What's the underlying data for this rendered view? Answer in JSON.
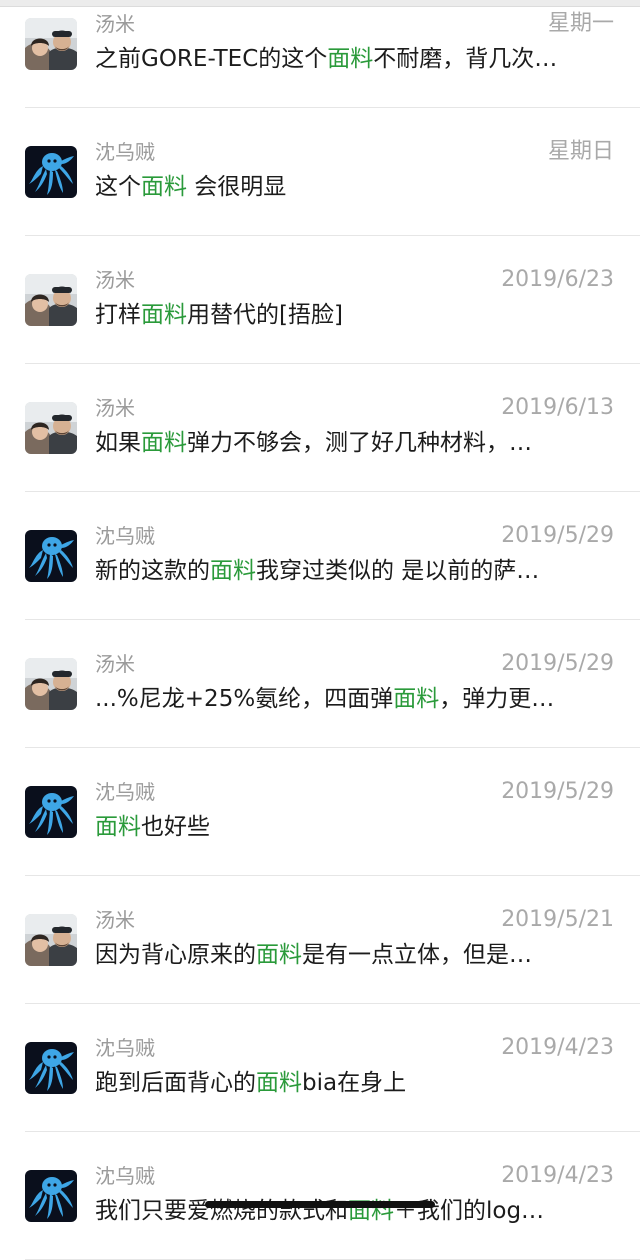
{
  "colors": {
    "highlight": "#2a9a3a",
    "name": "#9b9b9b",
    "date": "#a9a9a9",
    "text": "#1c1c1c",
    "divider": "#e6e6e6"
  },
  "messages": [
    {
      "sender": "汤米",
      "avatar": "couple-photo-avatar",
      "date": "星期一",
      "parts": [
        {
          "t": "之前GORE-TEC的这个",
          "hl": false
        },
        {
          "t": "面料",
          "hl": true
        },
        {
          "t": "不耐磨，背几次…",
          "hl": false
        }
      ]
    },
    {
      "sender": "沈乌贼",
      "avatar": "octopus-avatar",
      "date": "星期日",
      "parts": [
        {
          "t": "这个",
          "hl": false
        },
        {
          "t": "面料",
          "hl": true
        },
        {
          "t": " 会很明显",
          "hl": false
        }
      ]
    },
    {
      "sender": "汤米",
      "avatar": "couple-photo-avatar",
      "date": "2019/6/23",
      "parts": [
        {
          "t": "打样",
          "hl": false
        },
        {
          "t": "面料",
          "hl": true
        },
        {
          "t": "用替代的[捂脸]",
          "hl": false
        }
      ]
    },
    {
      "sender": "汤米",
      "avatar": "couple-photo-avatar",
      "date": "2019/6/13",
      "parts": [
        {
          "t": "如果",
          "hl": false
        },
        {
          "t": "面料",
          "hl": true
        },
        {
          "t": "弹力不够会，测了好几种材料，…",
          "hl": false
        }
      ]
    },
    {
      "sender": "沈乌贼",
      "avatar": "octopus-avatar",
      "date": "2019/5/29",
      "parts": [
        {
          "t": "新的这款的",
          "hl": false
        },
        {
          "t": "面料",
          "hl": true
        },
        {
          "t": "我穿过类似的 是以前的萨…",
          "hl": false
        }
      ]
    },
    {
      "sender": "汤米",
      "avatar": "couple-photo-avatar",
      "date": "2019/5/29",
      "parts": [
        {
          "t": "...%尼龙+25%氨纶，四面弹",
          "hl": false
        },
        {
          "t": "面料",
          "hl": true
        },
        {
          "t": "，弹力更…",
          "hl": false
        }
      ]
    },
    {
      "sender": "沈乌贼",
      "avatar": "octopus-avatar",
      "date": "2019/5/29",
      "parts": [
        {
          "t": "面料",
          "hl": true
        },
        {
          "t": "也好些",
          "hl": false
        }
      ]
    },
    {
      "sender": "汤米",
      "avatar": "couple-photo-avatar",
      "date": "2019/5/21",
      "parts": [
        {
          "t": "因为背心原来的",
          "hl": false
        },
        {
          "t": "面料",
          "hl": true
        },
        {
          "t": "是有一点立体，但是…",
          "hl": false
        }
      ]
    },
    {
      "sender": "沈乌贼",
      "avatar": "octopus-avatar",
      "date": "2019/4/23",
      "parts": [
        {
          "t": "跑到后面背心的",
          "hl": false
        },
        {
          "t": "面料",
          "hl": true
        },
        {
          "t": "bia在身上",
          "hl": false
        }
      ]
    },
    {
      "sender": "沈乌贼",
      "avatar": "octopus-avatar",
      "date": "2019/4/23",
      "parts": [
        {
          "t": "我们只要爱燃烧的款式和",
          "hl": false
        },
        {
          "t": "面料",
          "hl": true
        },
        {
          "t": "＋我们的log…",
          "hl": false
        }
      ]
    }
  ]
}
